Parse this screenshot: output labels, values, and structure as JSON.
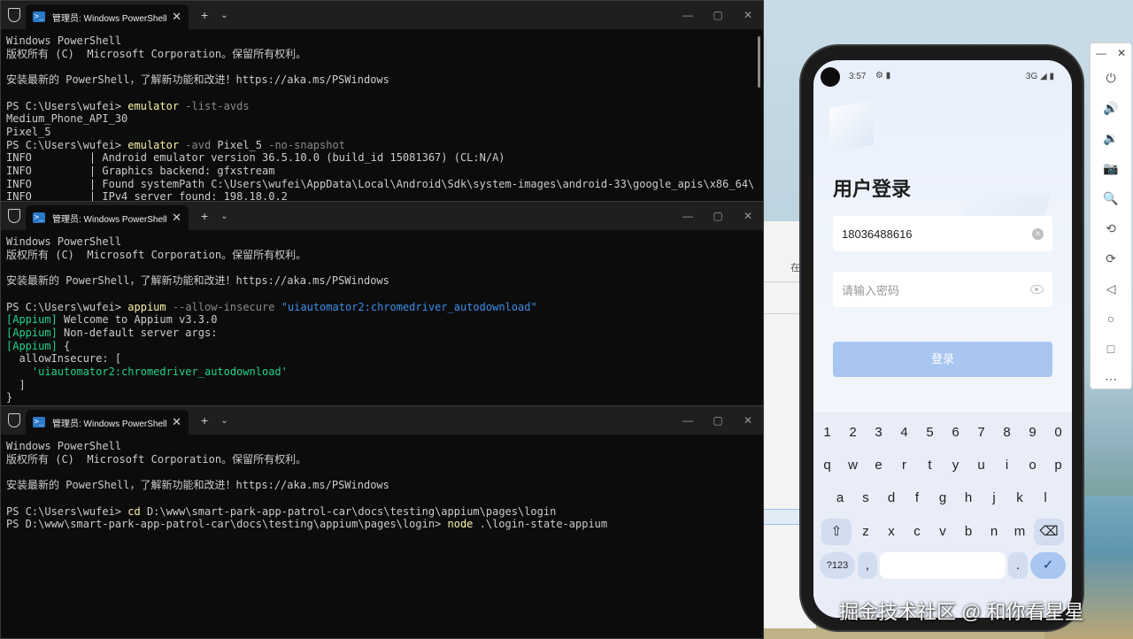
{
  "colors": {
    "terminal_bg": "#0c0c0c",
    "titlebar_bg": "#1f1f1f",
    "prompt_cmd": "#f9f1a5",
    "param": "#8a8a8a",
    "string": "#3b8eea",
    "appium": "#23d18b",
    "login_button": "#a9c6f0"
  },
  "terminals": [
    {
      "tab_title": "管理员: Windows PowerShell",
      "lines": [
        [
          {
            "t": "Windows PowerShell"
          }
        ],
        [
          {
            "t": "版权所有 (C)  Microsoft Corporation。保留所有权利。"
          }
        ],
        [
          {
            "t": ""
          }
        ],
        [
          {
            "t": "安装最新的 PowerShell，了解新功能和改进！https://aka.ms/PSWindows"
          }
        ],
        [
          {
            "t": ""
          }
        ],
        [
          {
            "t": "PS C:\\Users\\wufei> "
          },
          {
            "t": "emulator",
            "c": "y"
          },
          {
            "t": " -list-avds",
            "c": "g"
          }
        ],
        [
          {
            "t": "Medium_Phone_API_30"
          }
        ],
        [
          {
            "t": "Pixel_5"
          }
        ],
        [
          {
            "t": "PS C:\\Users\\wufei> "
          },
          {
            "t": "emulator",
            "c": "y"
          },
          {
            "t": " -avd",
            "c": "g"
          },
          {
            "t": " Pixel_5"
          },
          {
            "t": " -no-snapshot",
            "c": "g"
          }
        ],
        [
          {
            "t": "INFO         | Android emulator version 36.5.10.0 (build_id 15081367) (CL:N/A)"
          }
        ],
        [
          {
            "t": "INFO         | Graphics backend: gfxstream"
          }
        ],
        [
          {
            "t": "INFO         | Found systemPath C:\\Users\\wufei\\AppData\\Local\\Android\\Sdk\\system-images\\android-33\\google_apis\\x86_64\\"
          }
        ],
        [
          {
            "t": "INFO         | IPv4 server found: 198.18.0.2"
          }
        ]
      ]
    },
    {
      "tab_title": "管理员: Windows PowerShell",
      "lines": [
        [
          {
            "t": "Windows PowerShell"
          }
        ],
        [
          {
            "t": "版权所有 (C)  Microsoft Corporation。保留所有权利。"
          }
        ],
        [
          {
            "t": ""
          }
        ],
        [
          {
            "t": "安装最新的 PowerShell，了解新功能和改进！https://aka.ms/PSWindows"
          }
        ],
        [
          {
            "t": ""
          }
        ],
        [
          {
            "t": "PS C:\\Users\\wufei> "
          },
          {
            "t": "appium",
            "c": "y"
          },
          {
            "t": " --allow-insecure",
            "c": "g"
          },
          {
            "t": " \"uiautomator2:chromedriver_autodownload\"",
            "c": "b"
          }
        ],
        [
          {
            "t": "[Appium]",
            "c": "gr"
          },
          {
            "t": " Welcome to Appium v3.3.0"
          }
        ],
        [
          {
            "t": "[Appium]",
            "c": "gr"
          },
          {
            "t": " Non-default server args:"
          }
        ],
        [
          {
            "t": "[Appium]",
            "c": "gr"
          },
          {
            "t": " {"
          }
        ],
        [
          {
            "t": "  allowInsecure: ["
          }
        ],
        [
          {
            "t": "    'uiautomator2:chromedriver_autodownload'",
            "c": "gr"
          }
        ],
        [
          {
            "t": "  ]"
          }
        ],
        [
          {
            "t": "}"
          }
        ]
      ]
    },
    {
      "tab_title": "管理员: Windows PowerShell",
      "lines": [
        [
          {
            "t": "Windows PowerShell"
          }
        ],
        [
          {
            "t": "版权所有 (C)  Microsoft Corporation。保留所有权利。"
          }
        ],
        [
          {
            "t": ""
          }
        ],
        [
          {
            "t": "安装最新的 PowerShell，了解新功能和改进！https://aka.ms/PSWindows"
          }
        ],
        [
          {
            "t": ""
          }
        ],
        [
          {
            "t": "PS C:\\Users\\wufei> "
          },
          {
            "t": "cd",
            "c": "y"
          },
          {
            "t": " D:\\www\\smart-park-app-patrol-car\\docs\\testing\\appium\\pages\\login"
          }
        ],
        [
          {
            "t": "PS D:\\www\\smart-park-app-patrol-car\\docs\\testing\\appium\\pages\\login> "
          },
          {
            "t": "node",
            "c": "y"
          },
          {
            "t": " .\\login-state-appium"
          }
        ]
      ]
    }
  ],
  "titlebar": {
    "new_tab": "+",
    "dropdown": "⌄",
    "tab_close": "✕",
    "minimize": "—",
    "maximize": "▢",
    "close": "✕"
  },
  "bg_window": {
    "tab_label": "在"
  },
  "phone": {
    "status_time": "3:57",
    "status_icons": "⚙ ▮",
    "network": "3G ◢ ▮",
    "title": "用户登录",
    "phone_value": "18036488616",
    "password_placeholder": "请输入密码",
    "login_button": "登录",
    "keyboard": {
      "row1": [
        "1",
        "2",
        "3",
        "4",
        "5",
        "6",
        "7",
        "8",
        "9",
        "0"
      ],
      "row2": [
        "q",
        "w",
        "e",
        "r",
        "t",
        "y",
        "u",
        "i",
        "o",
        "p"
      ],
      "row3": [
        "a",
        "s",
        "d",
        "f",
        "g",
        "h",
        "j",
        "k",
        "l"
      ],
      "row4": [
        "⇧",
        "z",
        "x",
        "c",
        "v",
        "b",
        "n",
        "m",
        "⌫"
      ],
      "sym": "?123",
      "comma": ",",
      "period": ".",
      "enter": "✓"
    }
  },
  "side_toolbar": {
    "header": [
      "—",
      "✕"
    ],
    "icons": [
      {
        "name": "power-icon",
        "glyph": "⏻"
      },
      {
        "name": "volume-up-icon",
        "glyph": "🔊"
      },
      {
        "name": "volume-down-icon",
        "glyph": "🔉"
      },
      {
        "name": "camera-icon",
        "glyph": "📷"
      },
      {
        "name": "zoom-icon",
        "glyph": "🔍"
      },
      {
        "name": "rotate-left-icon",
        "glyph": "⟲"
      },
      {
        "name": "rotate-right-icon",
        "glyph": "⟳"
      },
      {
        "name": "back-icon",
        "glyph": "◁"
      },
      {
        "name": "home-icon",
        "glyph": "○"
      },
      {
        "name": "overview-icon",
        "glyph": "□"
      },
      {
        "name": "more-icon",
        "glyph": "⋯"
      }
    ]
  },
  "watermark": "掘金技术社区 @ 和你看星星"
}
